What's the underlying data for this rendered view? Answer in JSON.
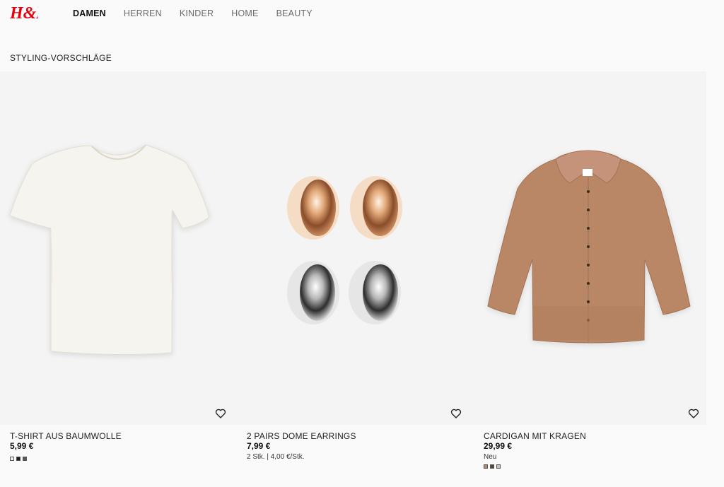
{
  "brand": {
    "logo_text": "H&M",
    "color": "#e50010"
  },
  "nav": {
    "items": [
      {
        "label": "DAMEN",
        "active": true
      },
      {
        "label": "HERREN",
        "active": false
      },
      {
        "label": "KINDER",
        "active": false
      },
      {
        "label": "HOME",
        "active": false
      },
      {
        "label": "BEAUTY",
        "active": false
      }
    ]
  },
  "section": {
    "title": "STYLING-VORSCHLÄGE"
  },
  "products": [
    {
      "name": "T-SHIRT AUS BAUMWOLLE",
      "price": "5,99 €",
      "sub": "",
      "swatches": [
        "#f2f0ea",
        "#1d1d1d",
        "#555a58"
      ],
      "image_icon": "white-tshirt-image",
      "favorite_icon": "heart-icon"
    },
    {
      "name": "2 PAIRS DOME EARRINGS",
      "price": "7,99 €",
      "sub": "2 Stk. | 4,00 €/Stk.",
      "swatches": [],
      "image_icon": "dome-earrings-image",
      "favorite_icon": "heart-icon"
    },
    {
      "name": "CARDIGAN MIT KRAGEN",
      "price": "29,99 €",
      "sub": "Neu",
      "swatches": [
        "#b98766",
        "#4f4a45",
        "#c8c3b8"
      ],
      "image_icon": "brown-cardigan-image",
      "favorite_icon": "heart-icon"
    }
  ]
}
